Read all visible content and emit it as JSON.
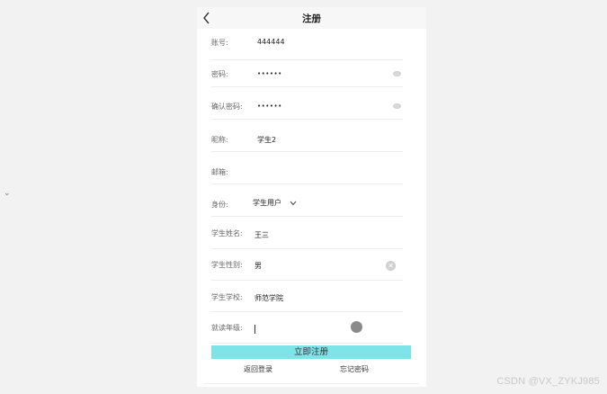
{
  "header": {
    "title": "注册"
  },
  "form": {
    "account": {
      "label": "账号:",
      "value": "444444"
    },
    "password": {
      "label": "密码:",
      "value": "••••••"
    },
    "confirm": {
      "label": "确认密码:",
      "value": "••••••"
    },
    "nickname": {
      "label": "昵称:",
      "value": "学生2"
    },
    "email": {
      "label": "邮箱:",
      "value": ""
    },
    "identity": {
      "label": "身份:",
      "value": "学生用户"
    },
    "student_name": {
      "label": "学生姓名:",
      "value": "王三"
    },
    "student_gender": {
      "label": "学生性别:",
      "value": "男"
    },
    "student_school": {
      "label": "学生学校:",
      "value": "师范学院"
    },
    "grade": {
      "label": "就读年级:",
      "value": ""
    }
  },
  "actions": {
    "register": "立即注册",
    "back_to_login": "返回登录",
    "forgot_password": "忘记密码"
  },
  "watermark": "CSDN @VX_ZYKJ985",
  "colors": {
    "primary_button": "#7de4e8",
    "nav_bg": "#f7f7f7",
    "page_bg": "#f2f2f2"
  }
}
